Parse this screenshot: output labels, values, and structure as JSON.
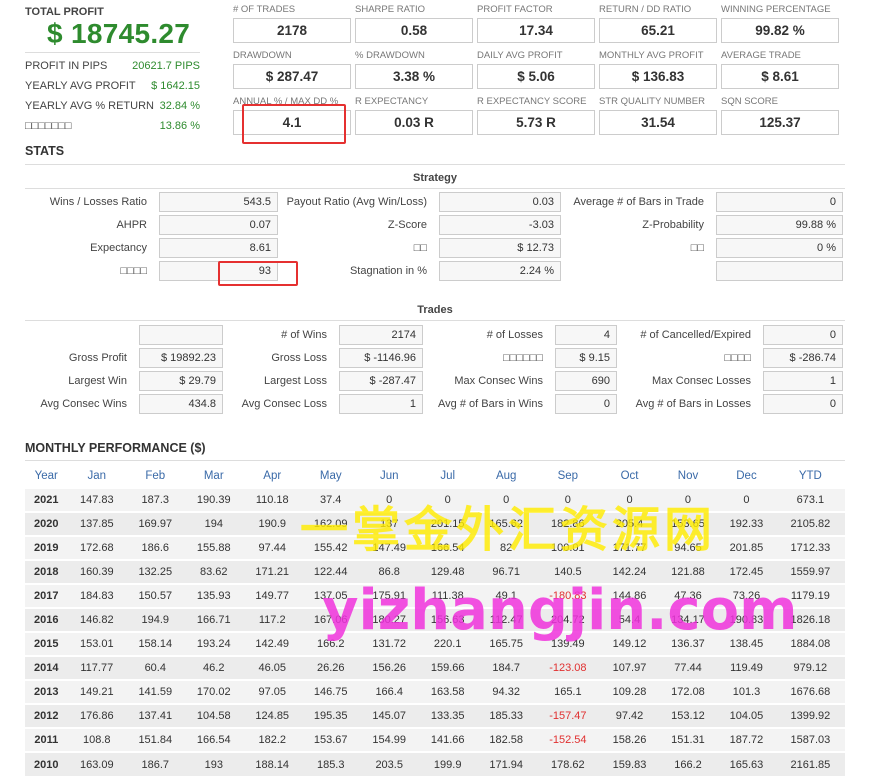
{
  "summary": {
    "total_profit_label": "TOTAL PROFIT",
    "total_profit_value": "$ 18745.27",
    "rows": [
      {
        "label": "PROFIT IN PIPS",
        "value": "20621.7 PIPS"
      },
      {
        "label": "YEARLY AVG PROFIT",
        "value": "$ 1642.15"
      },
      {
        "label": "YEARLY AVG % RETURN",
        "value": "32.84 %"
      },
      {
        "label": "□□□□□□□",
        "value": "13.86 %"
      }
    ]
  },
  "metrics": [
    {
      "label": "# OF TRADES",
      "value": "2178"
    },
    {
      "label": "SHARPE RATIO",
      "value": "0.58"
    },
    {
      "label": "PROFIT FACTOR",
      "value": "17.34"
    },
    {
      "label": "RETURN / DD RATIO",
      "value": "65.21"
    },
    {
      "label": "WINNING PERCENTAGE",
      "value": "99.82 %"
    },
    {
      "label": "DRAWDOWN",
      "value": "$ 287.47"
    },
    {
      "label": "% DRAWDOWN",
      "value": "3.38 %"
    },
    {
      "label": "DAILY AVG PROFIT",
      "value": "$ 5.06"
    },
    {
      "label": "MONTHLY AVG PROFIT",
      "value": "$ 136.83"
    },
    {
      "label": "AVERAGE TRADE",
      "value": "$ 8.61"
    },
    {
      "label": "ANNUAL % / MAX DD %",
      "value": "4.1"
    },
    {
      "label": "R EXPECTANCY",
      "value": "0.03 R"
    },
    {
      "label": "R EXPECTANCY SCORE",
      "value": "5.73 R"
    },
    {
      "label": "STR QUALITY NUMBER",
      "value": "31.54"
    },
    {
      "label": "SQN SCORE",
      "value": "125.37"
    }
  ],
  "stats": {
    "title": "STATS",
    "strategy_title": "Strategy",
    "strategy": [
      {
        "label": "Wins / Losses Ratio",
        "value": "543.5"
      },
      {
        "label": "Payout Ratio (Avg Win/Loss)",
        "value": "0.03"
      },
      {
        "label": "Average # of Bars in Trade",
        "value": "0"
      },
      {
        "label": "AHPR",
        "value": "0.07"
      },
      {
        "label": "Z-Score",
        "value": "-3.03"
      },
      {
        "label": "Z-Probability",
        "value": "99.88 %"
      },
      {
        "label": "Expectancy",
        "value": "8.61"
      },
      {
        "label": "□□",
        "value": "$ 12.73"
      },
      {
        "label": "□□",
        "value": "0 %"
      },
      {
        "label": "□□□□",
        "value": "93"
      },
      {
        "label": "Stagnation in %",
        "value": "2.24 %"
      },
      {
        "label": "",
        "value": ""
      }
    ],
    "trades_title": "Trades",
    "trades": [
      {
        "label": "",
        "value": ""
      },
      {
        "label": "# of Wins",
        "value": "2174"
      },
      {
        "label": "# of Losses",
        "value": "4"
      },
      {
        "label": "# of Cancelled/Expired",
        "value": "0"
      },
      {
        "label": "Gross Profit",
        "value": "$ 19892.23"
      },
      {
        "label": "Gross Loss",
        "value": "$ -1146.96"
      },
      {
        "label": "□□□□□□",
        "value": "$ 9.15"
      },
      {
        "label": "□□□□",
        "value": "$ -286.74"
      },
      {
        "label": "Largest Win",
        "value": "$ 29.79"
      },
      {
        "label": "Largest Loss",
        "value": "$ -287.47"
      },
      {
        "label": "Max Consec Wins",
        "value": "690"
      },
      {
        "label": "Max Consec Losses",
        "value": "1"
      },
      {
        "label": "Avg Consec Wins",
        "value": "434.8"
      },
      {
        "label": "Avg Consec Loss",
        "value": "1"
      },
      {
        "label": "Avg # of Bars in Wins",
        "value": "0"
      },
      {
        "label": "Avg # of Bars in Losses",
        "value": "0"
      }
    ]
  },
  "monthly": {
    "title": "MONTHLY PERFORMANCE ($)",
    "headers": [
      "Year",
      "Jan",
      "Feb",
      "Mar",
      "Apr",
      "May",
      "Jun",
      "Jul",
      "Aug",
      "Sep",
      "Oct",
      "Nov",
      "Dec",
      "YTD"
    ],
    "rows": [
      [
        "2021",
        "147.83",
        "187.3",
        "190.39",
        "110.18",
        "37.4",
        "0",
        "0",
        "0",
        "0",
        "0",
        "0",
        "0",
        "673.1"
      ],
      [
        "2020",
        "137.85",
        "169.97",
        "194",
        "190.9",
        "162.09",
        "137",
        "201.15",
        "165.62",
        "182.86",
        "205.4",
        "153.65",
        "192.33",
        "2105.82"
      ],
      [
        "2019",
        "172.68",
        "186.6",
        "155.88",
        "97.44",
        "155.42",
        "147.49",
        "166.54",
        "82",
        "100.01",
        "171.77",
        "94.65",
        "201.85",
        "1712.33"
      ],
      [
        "2018",
        "160.39",
        "132.25",
        "83.62",
        "171.21",
        "122.44",
        "86.8",
        "129.48",
        "96.71",
        "140.5",
        "142.24",
        "121.88",
        "172.45",
        "1559.97"
      ],
      [
        "2017",
        "184.83",
        "150.57",
        "135.93",
        "149.77",
        "137.05",
        "175.91",
        "111.38",
        "49.1",
        "-180.83",
        "144.86",
        "47.36",
        "73.26",
        "1179.19"
      ],
      [
        "2016",
        "146.82",
        "194.9",
        "166.71",
        "117.2",
        "167.06",
        "180.27",
        "156.63",
        "112.47",
        "204.72",
        "54.4",
        "134.17",
        "190.83",
        "1826.18"
      ],
      [
        "2015",
        "153.01",
        "158.14",
        "193.24",
        "142.49",
        "166.2",
        "131.72",
        "220.1",
        "165.75",
        "139.49",
        "149.12",
        "136.37",
        "138.45",
        "1884.08"
      ],
      [
        "2014",
        "117.77",
        "60.4",
        "46.2",
        "46.05",
        "26.26",
        "156.26",
        "159.66",
        "184.7",
        "-123.08",
        "107.97",
        "77.44",
        "119.49",
        "979.12"
      ],
      [
        "2013",
        "149.21",
        "141.59",
        "170.02",
        "97.05",
        "146.75",
        "166.4",
        "163.58",
        "94.32",
        "165.1",
        "109.28",
        "172.08",
        "101.3",
        "1676.68"
      ],
      [
        "2012",
        "176.86",
        "137.41",
        "104.58",
        "124.85",
        "195.35",
        "145.07",
        "133.35",
        "185.33",
        "-157.47",
        "97.42",
        "153.12",
        "104.05",
        "1399.92"
      ],
      [
        "2011",
        "108.8",
        "151.84",
        "166.54",
        "182.2",
        "153.67",
        "154.99",
        "141.66",
        "182.58",
        "-152.54",
        "158.26",
        "151.31",
        "187.72",
        "1587.03"
      ],
      [
        "2010",
        "163.09",
        "186.7",
        "193",
        "188.14",
        "185.3",
        "203.5",
        "199.9",
        "171.94",
        "178.62",
        "159.83",
        "166.2",
        "165.63",
        "2161.85"
      ]
    ],
    "negative_color": "#e03030",
    "header_color": "#3a6aa8"
  },
  "watermark": {
    "line1": "一掌金外汇资源网",
    "line2": "yizhangjin.com"
  },
  "colors": {
    "profit_green": "#2e8b2e",
    "highlight_red": "#e53030"
  }
}
